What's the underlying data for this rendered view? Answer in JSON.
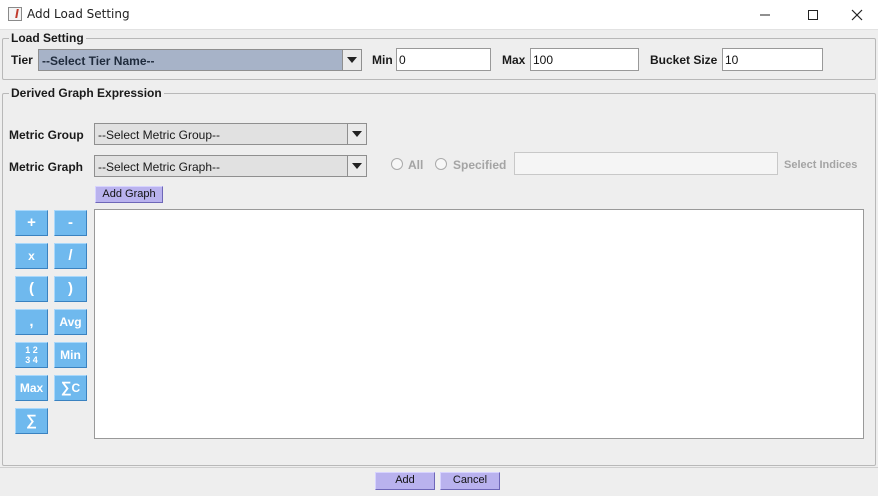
{
  "window": {
    "title": "Add Load Setting",
    "controls": {
      "minimize": "minimize",
      "maximize": "maximize",
      "close": "close"
    }
  },
  "load_setting": {
    "legend": "Load Setting",
    "tier_label": "Tier",
    "tier_value": "--Select Tier Name--",
    "min_label": "Min",
    "min_value": "0",
    "max_label": "Max",
    "max_value": "100",
    "bucket_label": "Bucket Size",
    "bucket_value": "10"
  },
  "derived": {
    "legend": "Derived Graph Expression",
    "metric_group_label": "Metric Group",
    "metric_group_value": "--Select Metric Group--",
    "metric_graph_label": "Metric Graph",
    "metric_graph_value": "--Select Metric Graph--",
    "all_label": "All",
    "specified_label": "Specified",
    "indices_value": "",
    "select_indices_label": "Select Indices",
    "add_graph_label": "Add Graph",
    "expression_value": "",
    "operators": {
      "plus": "+",
      "minus": "-",
      "multiply": "x",
      "divide": "/",
      "open_paren": "(",
      "close_paren": ")",
      "comma": ",",
      "avg": "Avg",
      "fraction_top": "1 2",
      "fraction_bottom": "3 4",
      "min": "Min",
      "max": "Max",
      "sum_c_sigma": "∑",
      "sum_c_letter": "C",
      "sum": "∑"
    }
  },
  "footer": {
    "add_label": "Add",
    "cancel_label": "Cancel"
  },
  "colors": {
    "operator_button": "#6fb9ee",
    "action_button": "#b9b2ee",
    "tier_combo": "#a7b3c8",
    "window_bg": "#eeeeee"
  }
}
